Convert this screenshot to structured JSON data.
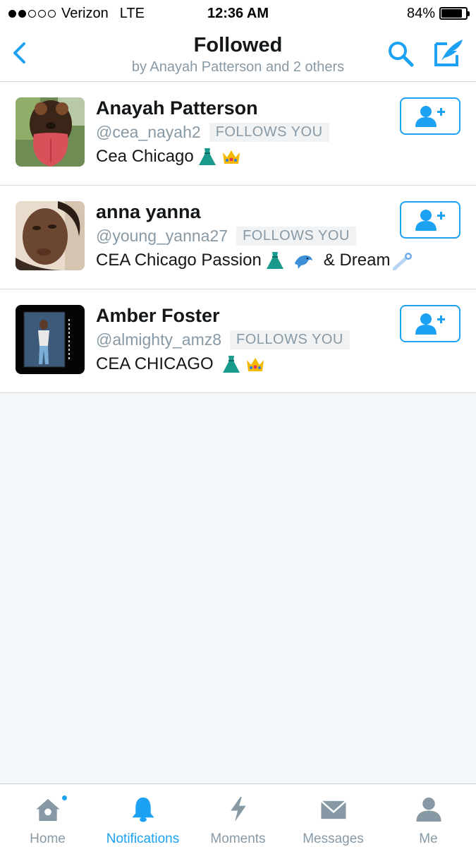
{
  "status_bar": {
    "carrier": "Verizon",
    "network": "LTE",
    "time": "12:36 AM",
    "battery": "84%",
    "battery_level": 0.84,
    "signal_bars": 2,
    "signal_total": 5
  },
  "header": {
    "title": "Followed",
    "subtitle": "by Anayah Patterson and 2 others"
  },
  "users": [
    {
      "name": "Anayah Patterson",
      "handle": "@cea_nayah2",
      "badge": "FOLLOWS YOU",
      "bio": "Cea Chicago",
      "bio_emojis": [
        "dress",
        "crown"
      ]
    },
    {
      "name": "anna yanna",
      "handle": "@young_yanna27",
      "badge": "FOLLOWS YOU",
      "bio": "CEA Chicago Passion",
      "bio_mid": "& Dream",
      "bio_emojis": [
        "dress",
        "dolphin",
        "comet"
      ]
    },
    {
      "name": "Amber Foster",
      "handle": "@almighty_amz8",
      "badge": "FOLLOWS YOU",
      "bio": "CEA CHICAGO",
      "bio_emojis": [
        "dress",
        "crown"
      ]
    }
  ],
  "tabs": [
    {
      "label": "Home",
      "icon": "home-icon",
      "active": false
    },
    {
      "label": "Notifications",
      "icon": "bell-icon",
      "active": true
    },
    {
      "label": "Moments",
      "icon": "lightning-icon",
      "active": false
    },
    {
      "label": "Messages",
      "icon": "envelope-icon",
      "active": false
    },
    {
      "label": "Me",
      "icon": "person-icon",
      "active": false
    }
  ],
  "colors": {
    "accent": "#1da1f2",
    "secondary_text": "#8899a6",
    "primary_text": "#14171a",
    "background": "#f5f8fa"
  }
}
